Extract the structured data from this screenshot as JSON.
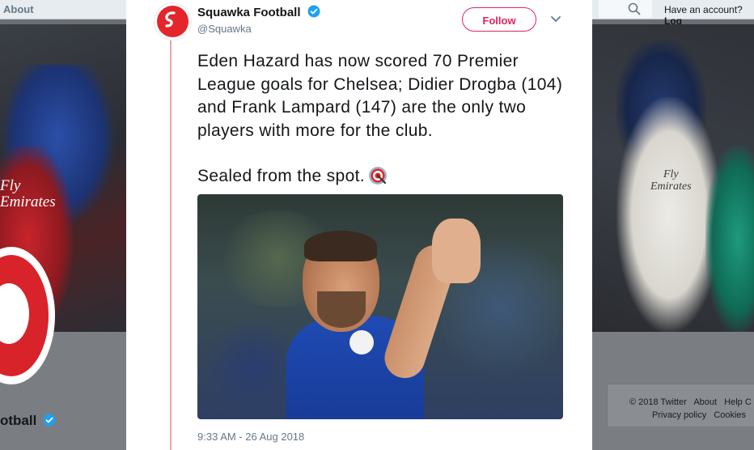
{
  "topbar": {
    "about": "About",
    "have_account": "Have an account?",
    "login": "Log"
  },
  "background": {
    "left_shirt_text": "Fly\nEmirates",
    "right_shirt_text": "Fly\nEmirates",
    "profile_name_fragment": "otball"
  },
  "footer": {
    "links": [
      "© 2018 Twitter",
      "About",
      "Help C",
      "Privacy policy",
      "Cookies"
    ]
  },
  "tweet": {
    "display_name": "Squawka Football",
    "handle": "@Squawka",
    "follow_label": "Follow",
    "paragraph1": "Eden Hazard has now scored 70 Premier League goals for Chelsea; Didier Drogba (104) and Frank Lampard (147) are the only two players with more for the club.",
    "paragraph2": "Sealed from the spot.",
    "timestamp": "9:33 AM - 26 Aug 2018"
  },
  "colors": {
    "brand_red": "#e2262c",
    "follow_pink": "#e0245e",
    "verified_blue": "#1da1f2",
    "thread_line": "#f0a4a6"
  },
  "icons": {
    "verified": "verified-badge-icon",
    "chevron": "chevron-down-icon",
    "search": "search-icon",
    "emoji": "direct-hit-target-emoji"
  }
}
